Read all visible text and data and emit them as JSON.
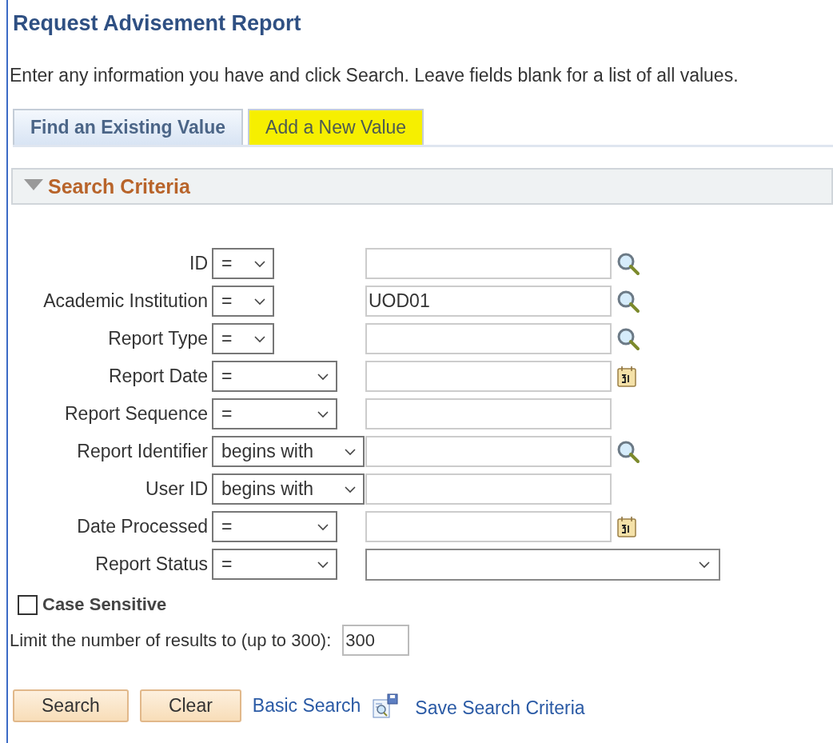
{
  "page": {
    "title": "Request Advisement Report",
    "instructions": "Enter any information you have and click Search. Leave fields blank for a list of all values."
  },
  "tabs": [
    {
      "label": "Find an Existing Value",
      "selected": true,
      "highlighted": false
    },
    {
      "label": "Add a New Value",
      "selected": false,
      "highlighted": true
    }
  ],
  "section": {
    "title": "Search Criteria",
    "expanded": true
  },
  "criteria": [
    {
      "label": "ID",
      "operator": "=",
      "kind": "lookup"
    },
    {
      "label": "Academic Institution",
      "operator": "=",
      "kind": "lookup",
      "value": "UOD01"
    },
    {
      "label": "Report Type",
      "operator": "=",
      "kind": "lookup"
    },
    {
      "label": "Report Date",
      "operator": "=",
      "kind": "date"
    },
    {
      "label": "Report Sequence",
      "operator": "=",
      "kind": "text"
    },
    {
      "label": "Report Identifier",
      "operator": "begins with",
      "kind": "lookup"
    },
    {
      "label": "User ID",
      "operator": "begins with",
      "kind": "text"
    },
    {
      "label": "Date Processed",
      "operator": "=",
      "kind": "date"
    },
    {
      "label": "Report Status",
      "operator": "=",
      "kind": "dropdown"
    }
  ],
  "case_sensitive": {
    "label": "Case Sensitive",
    "checked": false
  },
  "limit": {
    "label": "Limit the number of results to (up to 300):",
    "value": "300"
  },
  "actions": [
    {
      "kind": "button",
      "label": "Search"
    },
    {
      "kind": "button",
      "label": "Clear"
    },
    {
      "kind": "link",
      "label": "Basic Search"
    },
    {
      "kind": "icon-link",
      "label": "Save Search Criteria"
    }
  ]
}
